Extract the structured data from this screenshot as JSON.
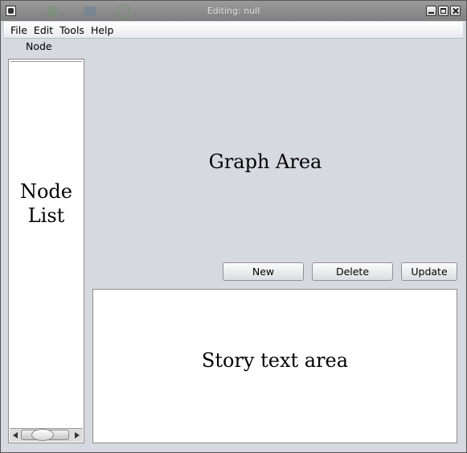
{
  "window": {
    "title": "Editing: null"
  },
  "menu": {
    "file": "File",
    "edit": "Edit",
    "tools": "Tools",
    "help": "Help"
  },
  "node_panel": {
    "label": "Node",
    "list_placeholder": "Node\nList"
  },
  "graph": {
    "label": "Graph Area"
  },
  "buttons": {
    "new": "New",
    "delete": "Delete",
    "update": "Update"
  },
  "story": {
    "label": "Story text area"
  }
}
